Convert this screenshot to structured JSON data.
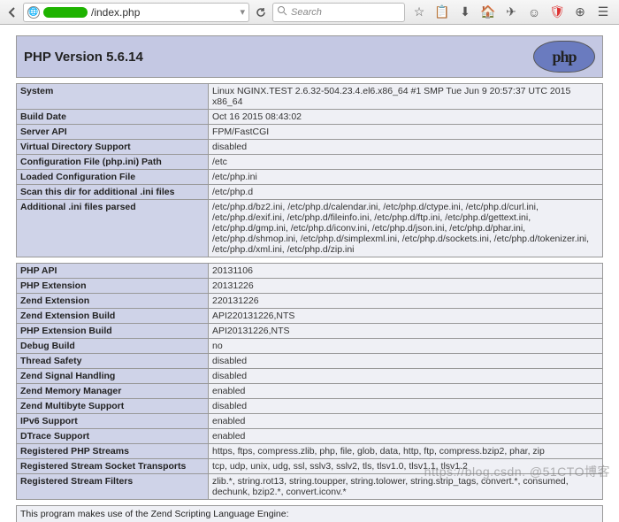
{
  "browser": {
    "url_suffix": "/index.php",
    "search_placeholder": "Search"
  },
  "header": {
    "title": "PHP Version 5.6.14",
    "logo_text": "php"
  },
  "table1": [
    {
      "k": "System",
      "v": "Linux NGINX.TEST 2.6.32-504.23.4.el6.x86_64 #1 SMP Tue Jun 9 20:57:37 UTC 2015 x86_64"
    },
    {
      "k": "Build Date",
      "v": "Oct 16 2015 08:43:02"
    },
    {
      "k": "Server API",
      "v": "FPM/FastCGI"
    },
    {
      "k": "Virtual Directory Support",
      "v": "disabled"
    },
    {
      "k": "Configuration File (php.ini) Path",
      "v": "/etc"
    },
    {
      "k": "Loaded Configuration File",
      "v": "/etc/php.ini"
    },
    {
      "k": "Scan this dir for additional .ini files",
      "v": "/etc/php.d"
    },
    {
      "k": "Additional .ini files parsed",
      "v": "/etc/php.d/bz2.ini, /etc/php.d/calendar.ini, /etc/php.d/ctype.ini, /etc/php.d/curl.ini, /etc/php.d/exif.ini, /etc/php.d/fileinfo.ini, /etc/php.d/ftp.ini, /etc/php.d/gettext.ini, /etc/php.d/gmp.ini, /etc/php.d/iconv.ini, /etc/php.d/json.ini, /etc/php.d/phar.ini, /etc/php.d/shmop.ini, /etc/php.d/simplexml.ini, /etc/php.d/sockets.ini, /etc/php.d/tokenizer.ini, /etc/php.d/xml.ini, /etc/php.d/zip.ini"
    }
  ],
  "table2": [
    {
      "k": "PHP API",
      "v": "20131106"
    },
    {
      "k": "PHP Extension",
      "v": "20131226"
    },
    {
      "k": "Zend Extension",
      "v": "220131226"
    },
    {
      "k": "Zend Extension Build",
      "v": "API220131226,NTS"
    },
    {
      "k": "PHP Extension Build",
      "v": "API20131226,NTS"
    },
    {
      "k": "Debug Build",
      "v": "no"
    },
    {
      "k": "Thread Safety",
      "v": "disabled"
    },
    {
      "k": "Zend Signal Handling",
      "v": "disabled"
    },
    {
      "k": "Zend Memory Manager",
      "v": "enabled"
    },
    {
      "k": "Zend Multibyte Support",
      "v": "disabled"
    },
    {
      "k": "IPv6 Support",
      "v": "enabled"
    },
    {
      "k": "DTrace Support",
      "v": "enabled"
    },
    {
      "k": "Registered PHP Streams",
      "v": "https, ftps, compress.zlib, php, file, glob, data, http, ftp, compress.bzip2, phar, zip"
    },
    {
      "k": "Registered Stream Socket Transports",
      "v": "tcp, udp, unix, udg, ssl, sslv3, sslv2, tls, tlsv1.0, tlsv1.1, tlsv1.2"
    },
    {
      "k": "Registered Stream Filters",
      "v": "zlib.*, string.rot13, string.toupper, string.tolower, string.strip_tags, convert.*, consumed, dechunk, bzip2.*, convert.iconv.*"
    }
  ],
  "footer": "This program makes use of the Zend Scripting Language Engine:",
  "watermark": "https://blog.csdn. @51CTO博客"
}
